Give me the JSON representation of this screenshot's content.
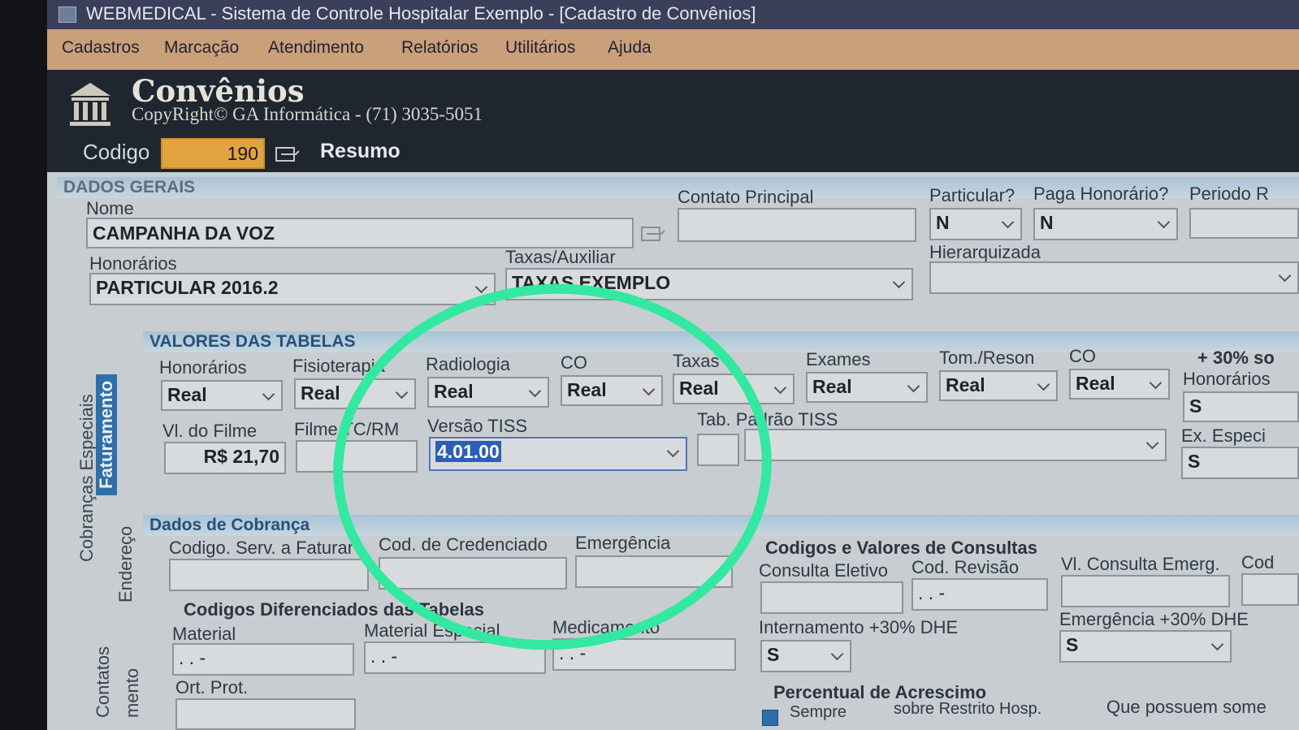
{
  "window": {
    "title": "WEBMEDICAL - Sistema de Controle Hospitalar Exemplo - [Cadastro de Convênios]"
  },
  "menu": [
    "Cadastros",
    "Marcação",
    "Atendimento",
    "Relatórios",
    "Utilitários",
    "Ajuda"
  ],
  "header": {
    "app_title": "Convênios",
    "copyright": "CopyRight© GA Informática - (71) 3035-5051",
    "codigo_label": "Codigo",
    "codigo_value": "190",
    "resumo_label": "Resumo"
  },
  "dados_gerais": {
    "section_title": "DADOS GERAIS",
    "nome_label": "Nome",
    "nome_value": "CAMPANHA DA VOZ",
    "contato_label": "Contato Principal",
    "contato_value": "",
    "particular_label": "Particular?",
    "particular_value": "N",
    "paga_honorario_label": "Paga Honorário?",
    "paga_honorario_value": "N",
    "periodo_label": "Periodo R",
    "honorarios_label": "Honorários",
    "honorarios_value": "PARTICULAR 2016.2",
    "taxas_label": "Taxas/Auxiliar",
    "taxas_value": "TAXAS EXEMPLO",
    "hierarquizada_label": "Hierarquizada"
  },
  "side_tabs": {
    "faturamento": "Faturamento",
    "cobrancas": "Cobranças Especiais",
    "endereco": "Endereço",
    "contatos": "Contatos",
    "lancamento": "mento"
  },
  "valores": {
    "section_title": "VALORES DAS TABELAS",
    "columns": [
      {
        "label": "Honorários",
        "value": "Real"
      },
      {
        "label": "Fisioterapia",
        "value": "Real"
      },
      {
        "label": "Radiologia",
        "value": "Real"
      },
      {
        "label": "CO",
        "value": "Real"
      },
      {
        "label": "Taxas",
        "value": "Real"
      },
      {
        "label": "Exames",
        "value": "Real"
      },
      {
        "label": "Tom./Reson",
        "value": "Real"
      },
      {
        "label": "CO",
        "value": "Real"
      }
    ],
    "plus30_label": "+ 30% so",
    "honorarios_30_label": "Honorários",
    "honorarios_30_value": "S",
    "ex_espec_label": "Ex. Especi",
    "ex_espec_value": "S",
    "filme_label": "Vl. do Filme",
    "filme_value": "R$ 21,70",
    "filme_tc_label": "Filme TC/RM",
    "versao_tiss_label": "Versão TISS",
    "versao_tiss_value": "4.01.00",
    "tab_padrao_label": "Tab. Padrão TISS"
  },
  "cobranca": {
    "section_title": "Dados de Cobrança",
    "cod_serv_label": "Codigo. Serv. a Faturar",
    "cod_cred_label": "Cod. de Credenciado",
    "emergencia_label": "Emergência",
    "dif_title": "Codigos Diferenciados das Tabelas",
    "material_label": "Material",
    "material_value": "  .  .  -",
    "mat_especial_label": "Material Especial",
    "mat_especial_value": "  .  .  -",
    "medicamento_label": "Medicamento",
    "medicamento_value": "  .  .  -",
    "ort_prot_label": "Ort. Prot."
  },
  "consultas": {
    "title": "Codigos e Valores de Consultas",
    "consulta_eletivo_label": "Consulta Eletivo",
    "cod_revisao_label": "Cod. Revisão",
    "cod_revisao_value": "  .  .  -",
    "vl_emerg_label": "Vl. Consulta Emerg.",
    "cod_label": "Cod",
    "internamento_label": "Internamento +30% DHE",
    "internamento_value": "S",
    "emergencia_30_label": "Emergência +30% DHE",
    "emergencia_30_value": "S",
    "percentual_title": "Percentual de Acrescimo",
    "sempre_label": "Sempre",
    "restrito_label": "sobre Restrito Hosp.",
    "possuem_label": "Que possuem some"
  },
  "colors": {
    "annotation": "#33e8a0",
    "codigo_field": "#e0a340",
    "menubar": "#c9a07a",
    "header": "#1f2630"
  }
}
